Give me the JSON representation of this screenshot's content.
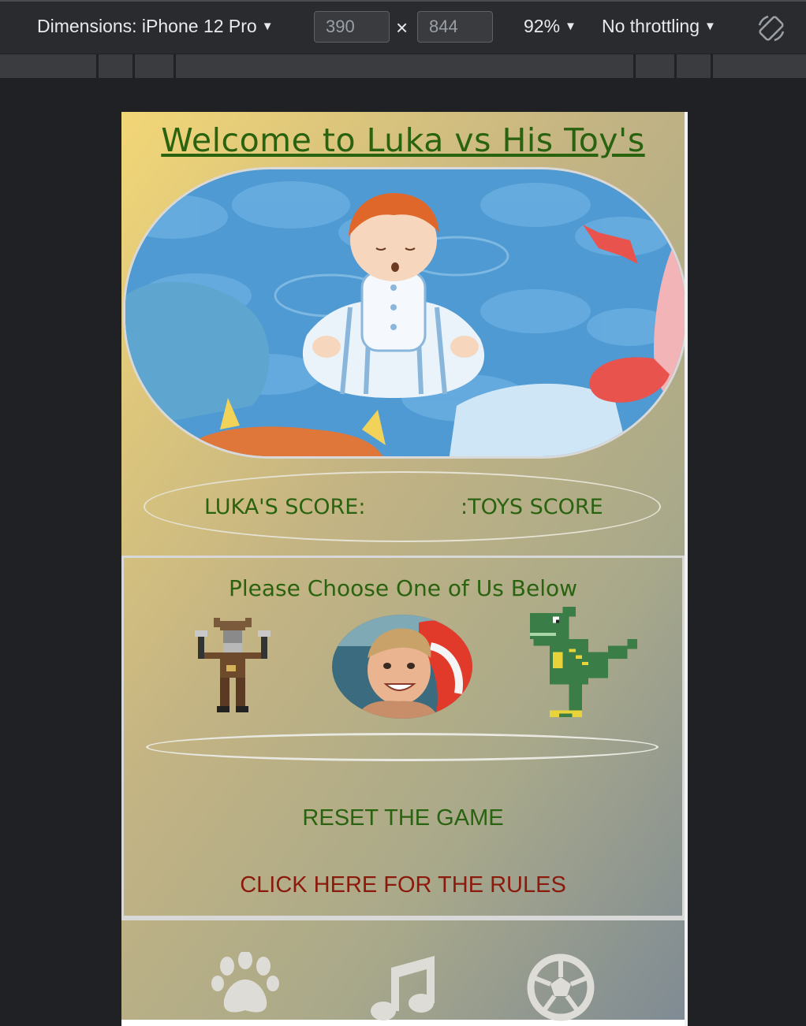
{
  "devtools": {
    "device_label": "Dimensions: iPhone 12 Pro",
    "width_value": "390",
    "height_value": "844",
    "times_symbol": "×",
    "zoom_label": "92%",
    "throttle_label": "No throttling",
    "caret": "▼"
  },
  "page": {
    "title": "Welcome to Luka vs His Toy's",
    "luka_score_label": "LUKA'S SCORE:",
    "toys_score_label": ":TOYS SCORE",
    "choose_text": "Please Choose One of Us Below",
    "result_text": "",
    "reset_label": "RESET THE GAME",
    "rules_label": "CLICK HERE FOR THE RULES"
  },
  "choices": [
    "viking-toy",
    "luka-photo",
    "dinosaur-toy"
  ],
  "footer_icons": [
    "paw-icon",
    "music-note-icon",
    "soccer-ball-icon"
  ],
  "colors": {
    "title_green": "#2a6310",
    "rules_red": "#8b1a0d",
    "icon_gray": "#d9d9d9"
  }
}
